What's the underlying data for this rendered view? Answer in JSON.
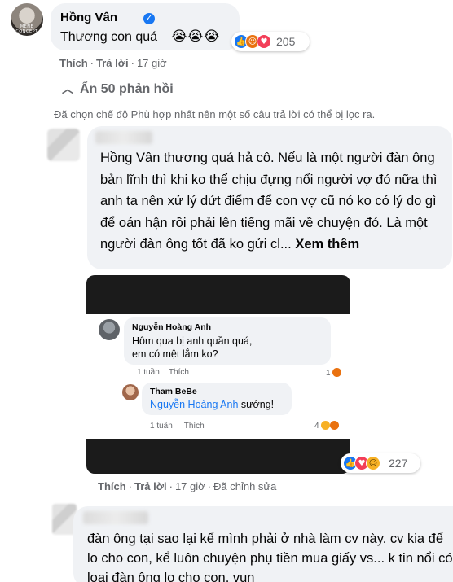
{
  "comment1": {
    "author": "Hồng Vân",
    "avatar_text": "MENE CONCEPT",
    "text": "Thương con quá",
    "emojis": "😭😭😭",
    "reaction_count": "205",
    "actions": {
      "like": "Thích",
      "reply": "Trả lời",
      "time": "17 giờ"
    }
  },
  "replies_toggle": "Ẩn 50 phản hồi",
  "filter_notice": "Đã chọn chế độ Phù hợp nhất nên một số câu trả lời có thể bị lọc ra.",
  "reply1": {
    "text": "Hồng Vân thương quá hả cô. Nếu là một người đàn ông bản lĩnh thì khi ko thể chịu đựng nổi người vợ đó nữa thì anh ta nên xử lý dứt điểm để con vợ cũ nó ko có lý do gì để oán hận rồi phải lên tiếng mãi về chuyện đó. Là một người đàn ông tốt đã ko gửi cl...",
    "see_more": "Xem thêm",
    "reaction_count": "227",
    "actions": {
      "like": "Thích",
      "reply": "Trả lời",
      "time": "17 giờ",
      "edited": "Đã chỉnh sửa"
    },
    "screenshot": {
      "c1": {
        "author": "Nguyễn Hoàng Anh",
        "text": "Hôm qua bị anh quần quá, em có mệt lắm ko?",
        "time": "1 tuần",
        "like": "Thích",
        "react_count": "1"
      },
      "c2": {
        "author": "Tham BeBe",
        "mention": "Nguyễn Hoàng Anh",
        "text": "sướng!",
        "time": "1 tuần",
        "like": "Thích",
        "react_count": "4"
      }
    }
  },
  "reply2": {
    "text": "đàn ông tại sao lại kể mình phải ở nhà làm cv này. cv kia để lo cho con, kể luôn chuyện phụ tiền mua giấy vs... k tin nổi có loại đàn ông lo cho con, vun"
  },
  "colors": {
    "bubble": "#f0f2f5",
    "meta": "#65676b",
    "link": "#1877f2"
  }
}
